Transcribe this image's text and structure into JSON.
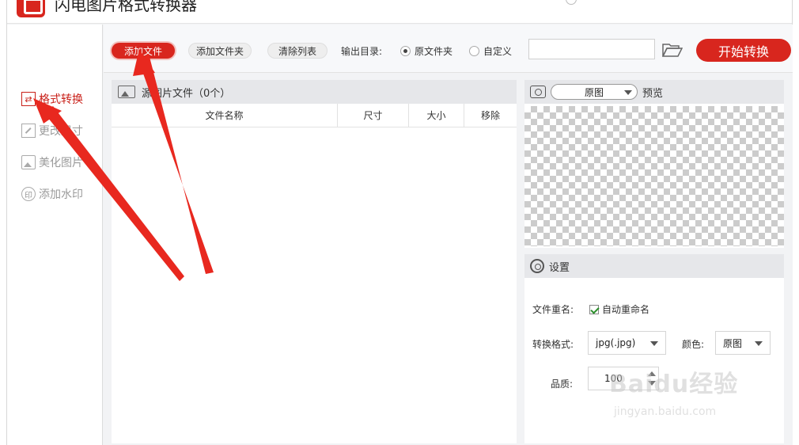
{
  "app": {
    "title": "闪电图片格式转换器"
  },
  "sidebar": {
    "items": [
      {
        "label": "格式转换",
        "icon": "format-convert-icon",
        "active": true
      },
      {
        "label": "更改尺寸",
        "icon": "resize-icon",
        "active": false
      },
      {
        "label": "美化图片",
        "icon": "beautify-image-icon",
        "active": false
      },
      {
        "label": "添加水印",
        "icon": "watermark-icon",
        "active": false
      }
    ]
  },
  "toolbar": {
    "add_file": "添加文件",
    "add_folder": "添加文件夹",
    "clear_list": "清除列表",
    "output_dir_label": "输出目录:",
    "output_options": [
      {
        "label": "原文件夹",
        "checked": true
      },
      {
        "label": "自定义",
        "checked": false
      }
    ],
    "output_path": "",
    "start": "开始转换"
  },
  "file_list": {
    "title": "源图片文件（0个）",
    "columns": [
      "文件名称",
      "尺寸",
      "大小",
      "移除"
    ],
    "rows": []
  },
  "preview": {
    "view_mode": "原图",
    "label": "预览"
  },
  "settings": {
    "title": "设置",
    "rename_label": "文件重名:",
    "auto_rename": "自动重命名",
    "auto_rename_checked": true,
    "format_label": "转换格式:",
    "format_value": "jpg(.jpg)",
    "color_label": "颜色:",
    "color_value": "原图",
    "quality_label": "品质:",
    "quality_value": "100"
  },
  "watermark": {
    "main": "Baidu经验",
    "sub": "jingyan.baidu.com"
  },
  "colors": {
    "accent": "#d8261e",
    "annotation_arrow": "#e8281f"
  }
}
